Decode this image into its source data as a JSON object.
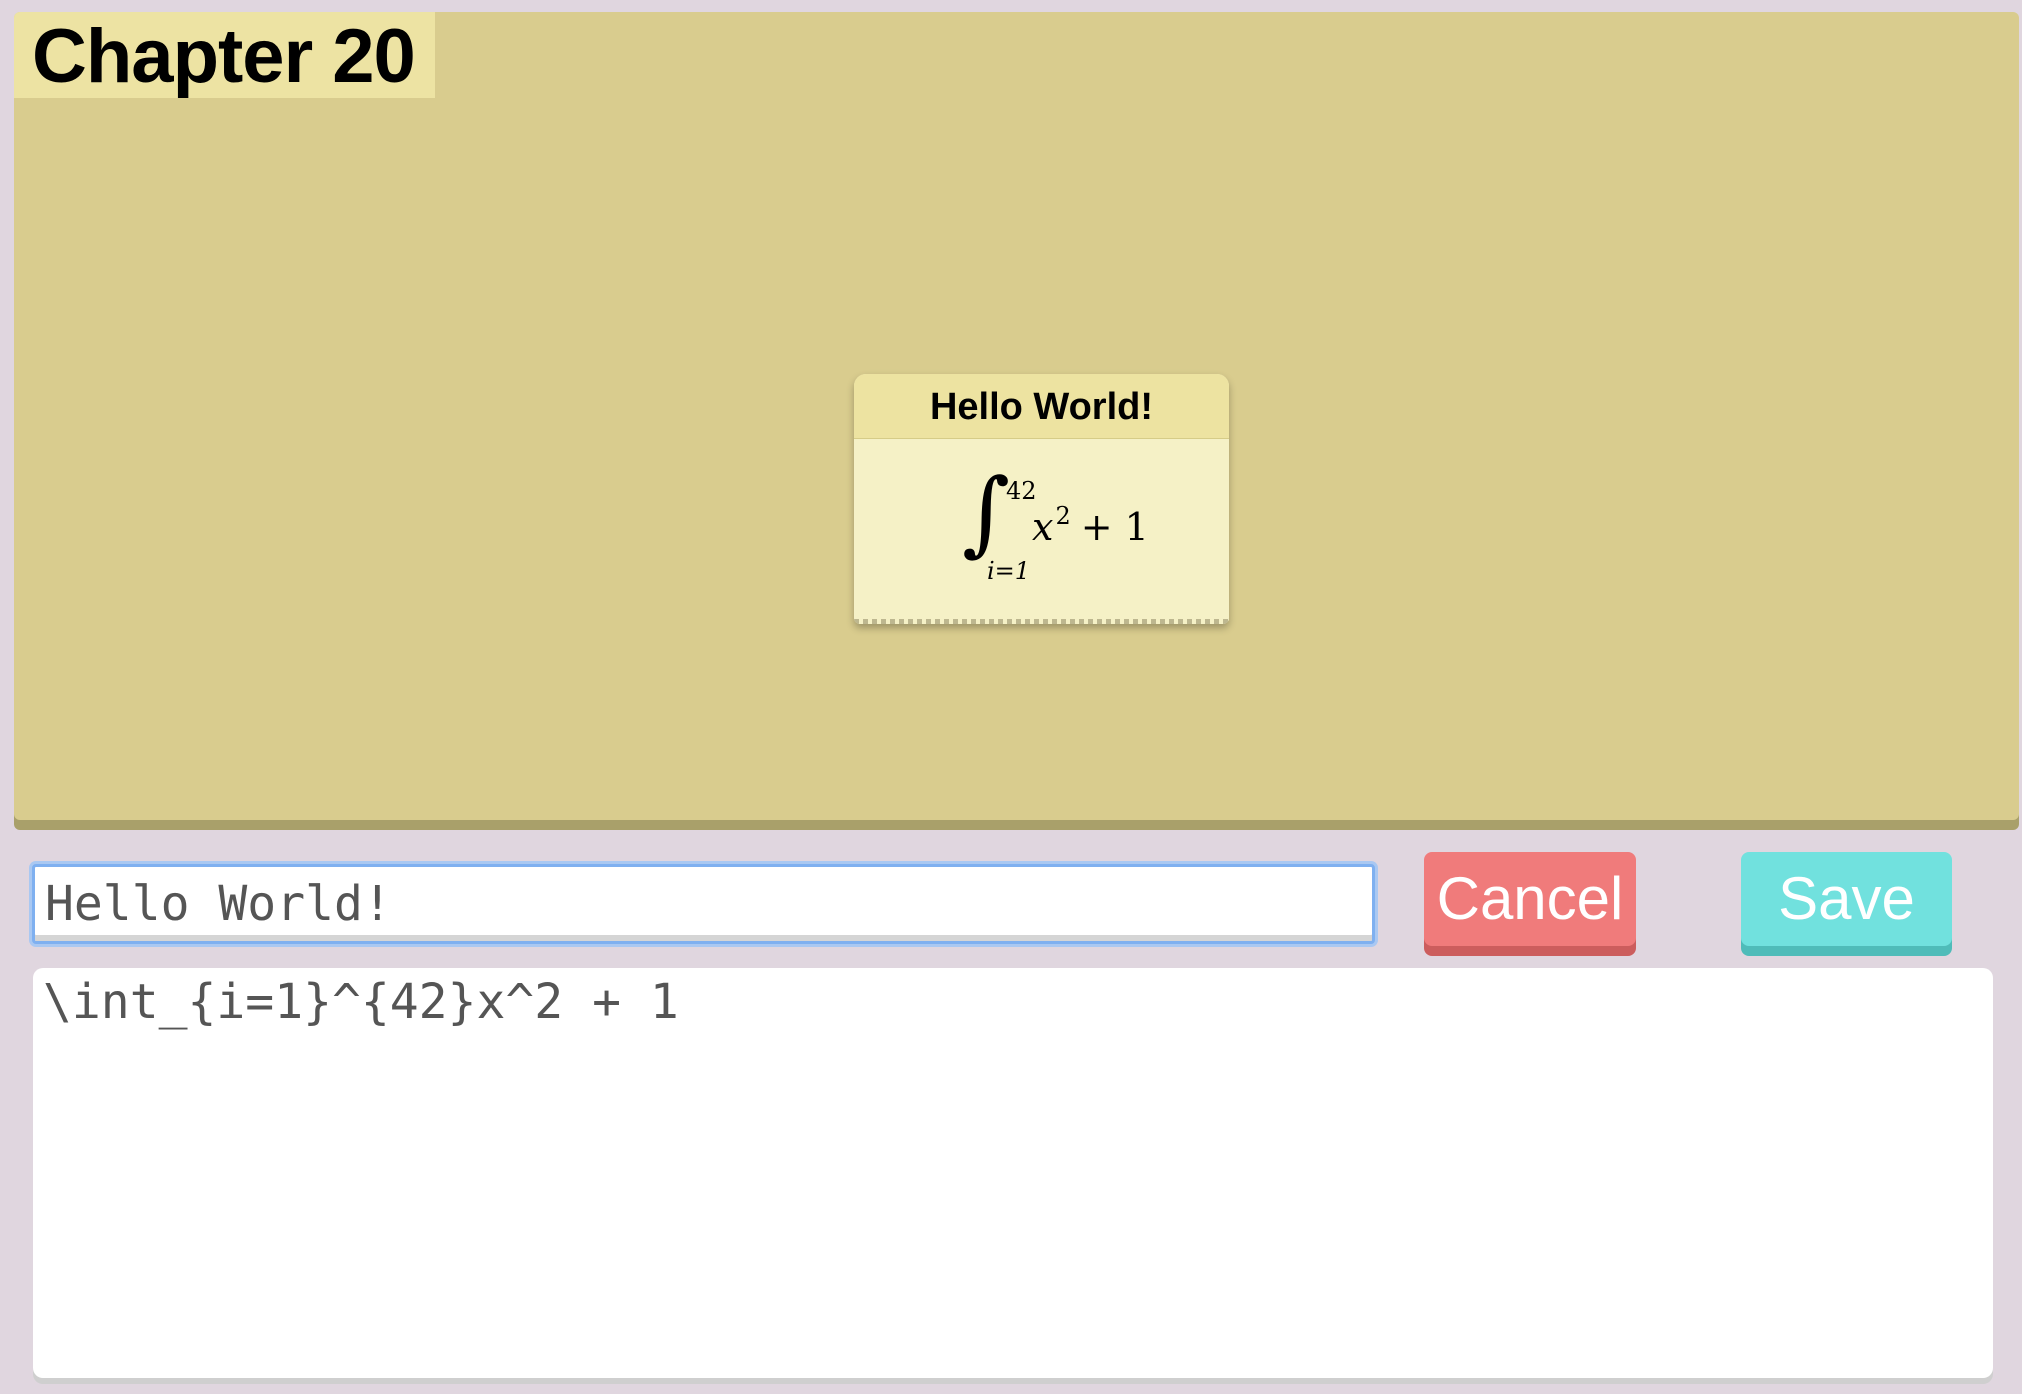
{
  "board": {
    "chapter_label": "Chapter 20"
  },
  "card": {
    "title": "Hello World!",
    "formula": {
      "integral_symbol": "∫",
      "lower_limit": "i=1",
      "upper_limit": "42",
      "variable": "x",
      "exponent": "2",
      "rest": "+ 1"
    }
  },
  "editor": {
    "title_value": "Hello World!",
    "latex_value": "\\int_{i=1}^{42}x^2 + 1",
    "cancel_label": "Cancel",
    "save_label": "Save"
  },
  "colors": {
    "background": "#e0d6df",
    "board": "#d9cc8e",
    "card": "#f5f1c6",
    "cancel": "#f07b7b",
    "save": "#71e1de",
    "focus_ring": "#7fb0f0"
  }
}
